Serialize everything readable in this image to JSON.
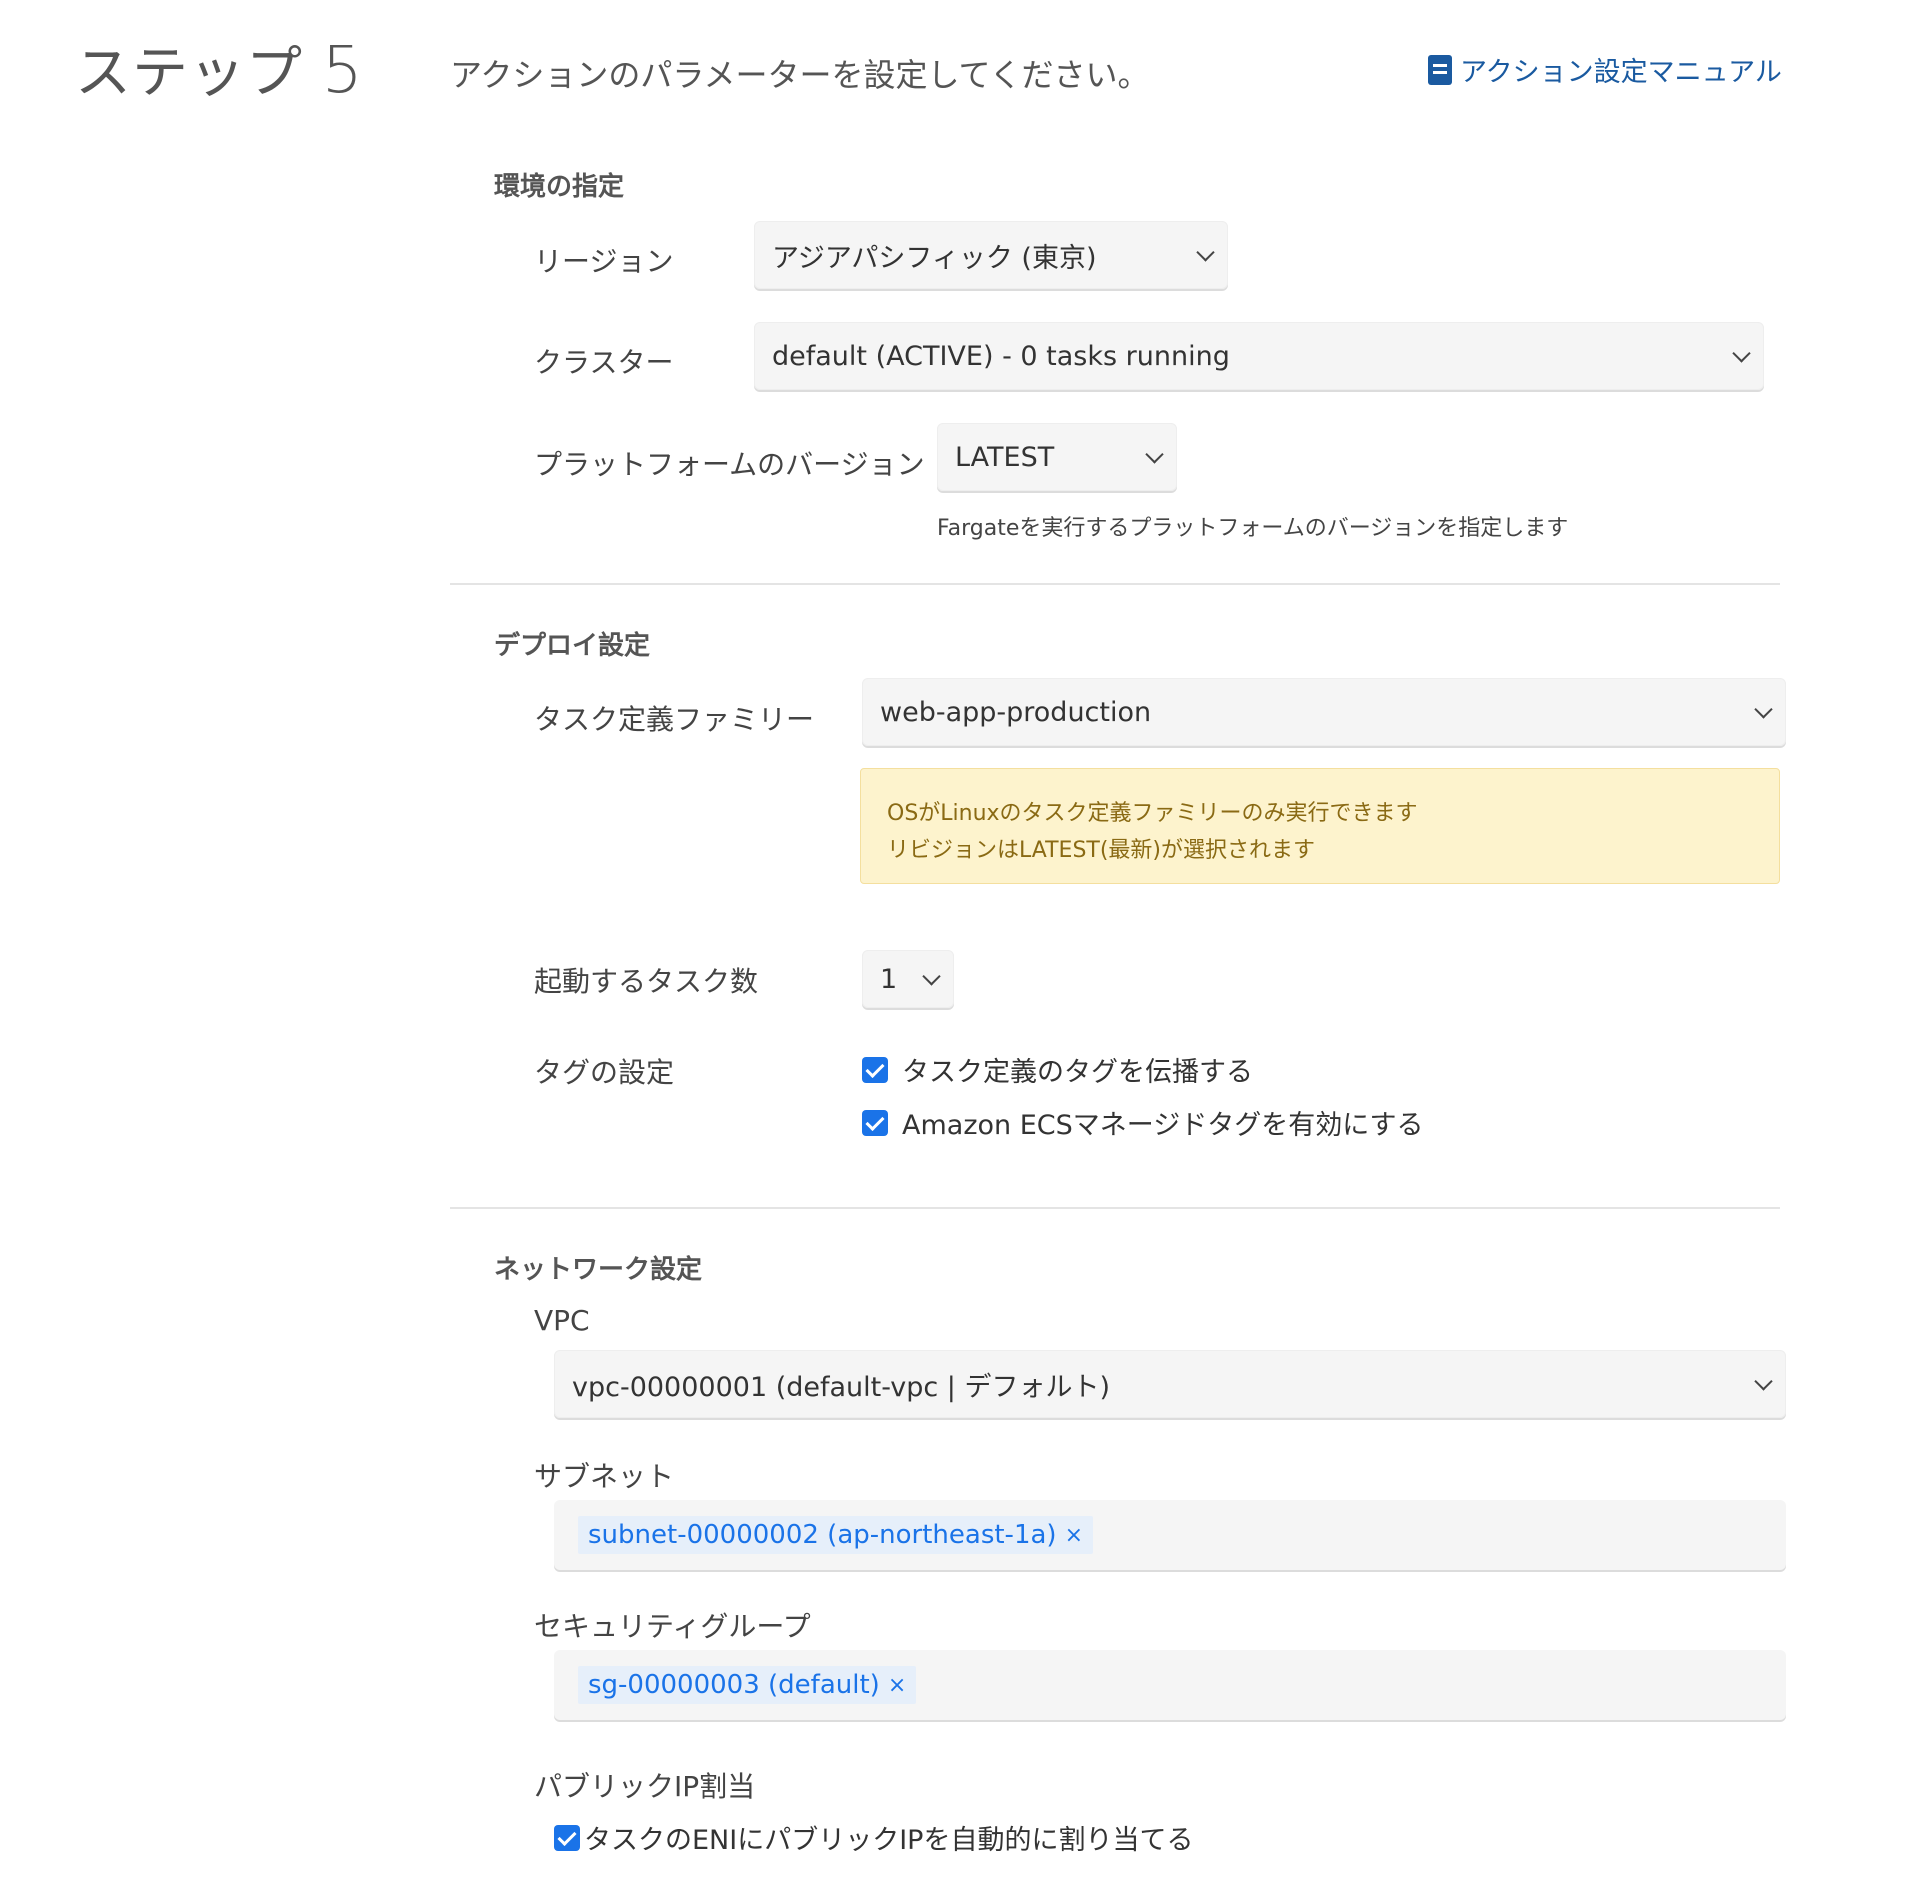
{
  "header": {
    "step_word": "ステップ",
    "step_number": "5",
    "description": "アクションのパラメーターを設定してください。",
    "manual_link": "アクション設定マニュアル"
  },
  "environment": {
    "title": "環境の指定",
    "region": {
      "label": "リージョン",
      "value": "アジアパシフィック (東京)"
    },
    "cluster": {
      "label": "クラスター",
      "value": "default (ACTIVE) - 0 tasks running"
    },
    "platform": {
      "label": "プラットフォームのバージョン",
      "value": "LATEST",
      "help": "Fargateを実行するプラットフォームのバージョンを指定します"
    }
  },
  "deploy": {
    "title": "デプロイ設定",
    "task_family": {
      "label": "タスク定義ファミリー",
      "value": "web-app-production"
    },
    "warning": {
      "line1": "OSがLinuxのタスク定義ファミリーのみ実行できます",
      "line2": "リビジョンはLATEST(最新)が選択されます"
    },
    "task_count": {
      "label": "起動するタスク数",
      "value": "1"
    },
    "tags": {
      "label": "タグの設定",
      "propagate": "タスク定義のタグを伝播する",
      "managed": "Amazon ECSマネージドタグを有効にする"
    }
  },
  "network": {
    "title": "ネットワーク設定",
    "vpc": {
      "label": "VPC",
      "value": "vpc-00000001 (default-vpc | デフォルト)"
    },
    "subnet": {
      "label": "サブネット",
      "tag": "subnet-00000002 (ap-northeast-1a)"
    },
    "security_group": {
      "label": "セキュリティグループ",
      "tag": "sg-00000003 (default)"
    },
    "public_ip": {
      "label": "パブリックIP割当",
      "checkbox": "タスクのENIにパブリックIPを自動的に割り当てる"
    },
    "remove_symbol": "×"
  }
}
